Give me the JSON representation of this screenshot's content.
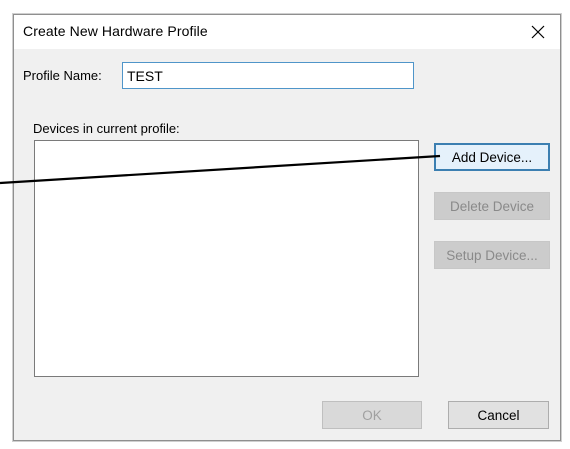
{
  "window": {
    "title": "Create New Hardware Profile",
    "close_glyph": "✕"
  },
  "form": {
    "profile_name_label": "Profile Name:",
    "profile_name_value": "TEST",
    "devices_label": "Devices in current profile:"
  },
  "buttons": {
    "add_device": "Add Device...",
    "delete_device": "Delete Device",
    "setup_device": "Setup Device...",
    "ok": "OK",
    "cancel": "Cancel"
  },
  "icons": {
    "close": "close-icon"
  },
  "colors": {
    "dialog_bg": "#f0f0f0",
    "focus_border": "#3c7fb1",
    "callout_line": "#000000"
  }
}
